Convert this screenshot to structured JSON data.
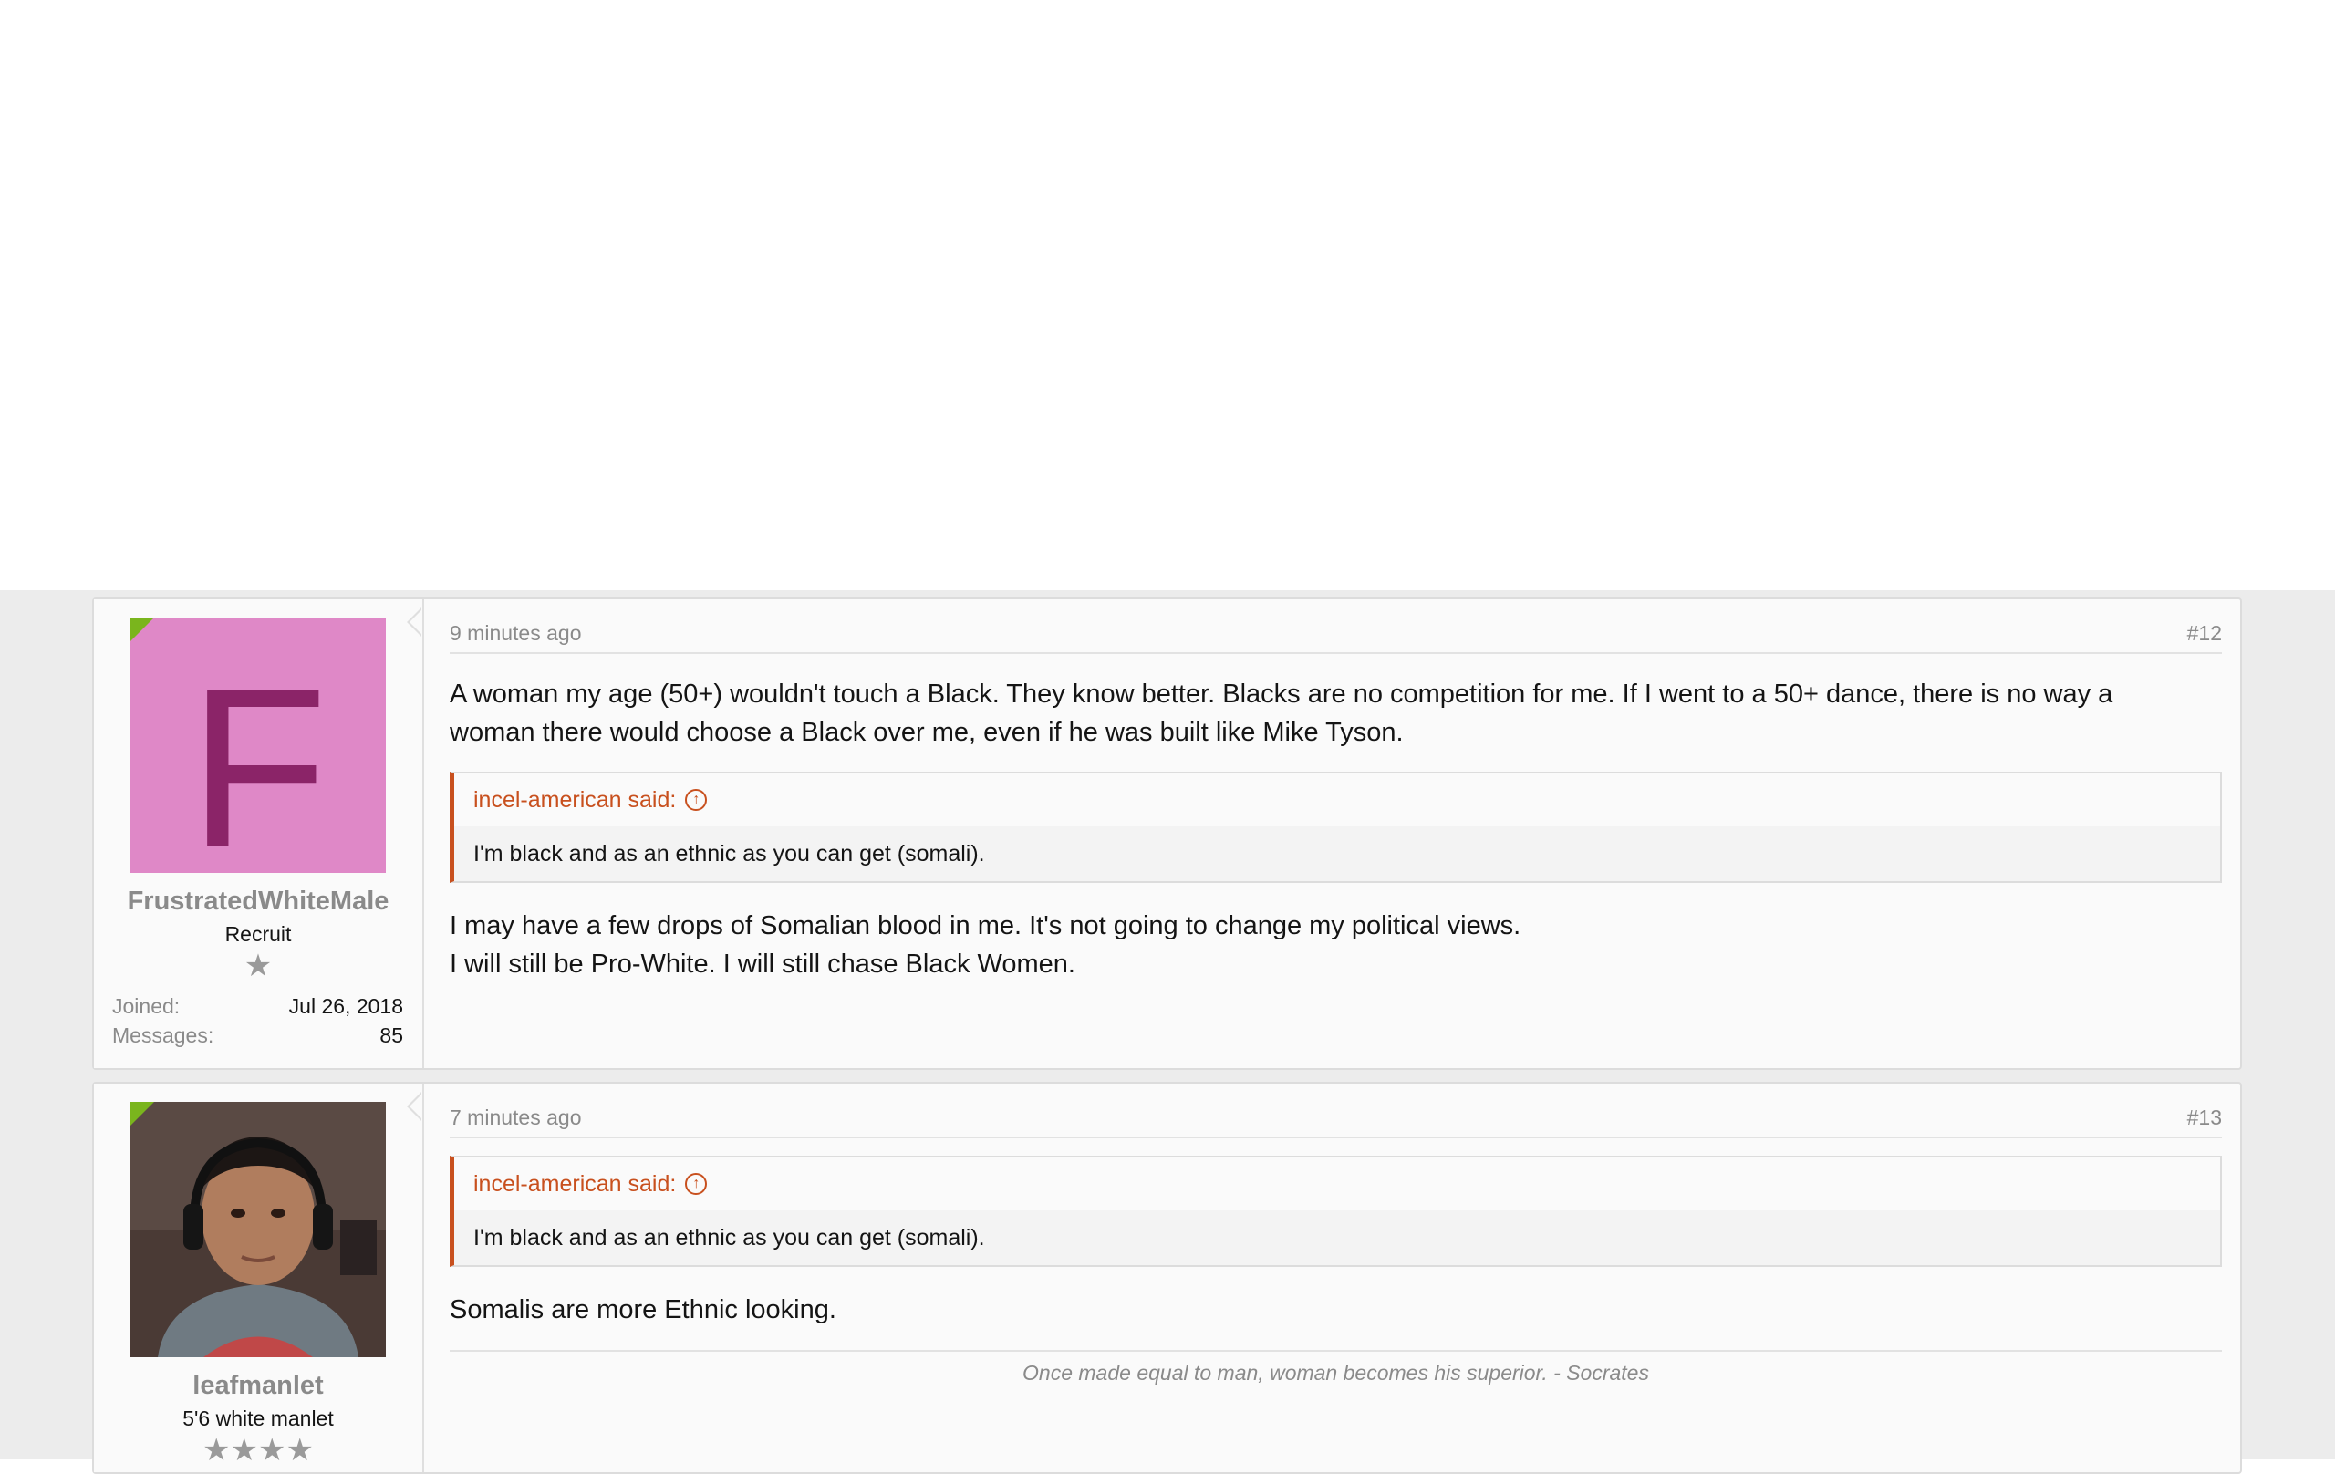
{
  "posts": [
    {
      "username": "FrustratedWhiteMale",
      "avatar_letter": "F",
      "user_title": "Recruit",
      "stars": "★",
      "joined_label": "Joined:",
      "joined_value": "Jul 26, 2018",
      "messages_label": "Messages:",
      "messages_value": "85",
      "time": "9 minutes ago",
      "number": "#12",
      "text_before": [
        "A woman my age (50+) wouldn't touch a Black. They know better. Blacks are no competition for me. If I went to a 50+ dance, there is no way a",
        "woman there would choose a Black over me, even if he was built like Mike Tyson."
      ],
      "quote_author": "incel-american said:",
      "quote_text": "I'm black and as an ethnic as you can get (somali).",
      "text_after": [
        "I may have a few drops of Somalian blood in me. It's not going to change my political views.",
        "I will still be Pro-White. I will still chase Black Women."
      ],
      "avatar_color": "#df88c7",
      "avatar_letter_color": "#8b2468"
    },
    {
      "username": "leafmanlet",
      "user_title": "5'6 white manlet",
      "stars": "★★★★",
      "time": "7 minutes ago",
      "number": "#13",
      "quote_author": "incel-american said:",
      "quote_text": "I'm black and as an ethnic as you can get (somali).",
      "text_after": [
        "Somalis are more Ethnic looking."
      ],
      "signature": "Once made equal to man, woman becomes his superior. - Socrates"
    }
  ],
  "colors": {
    "accent": "#c8501e",
    "online": "#7ab51d"
  }
}
